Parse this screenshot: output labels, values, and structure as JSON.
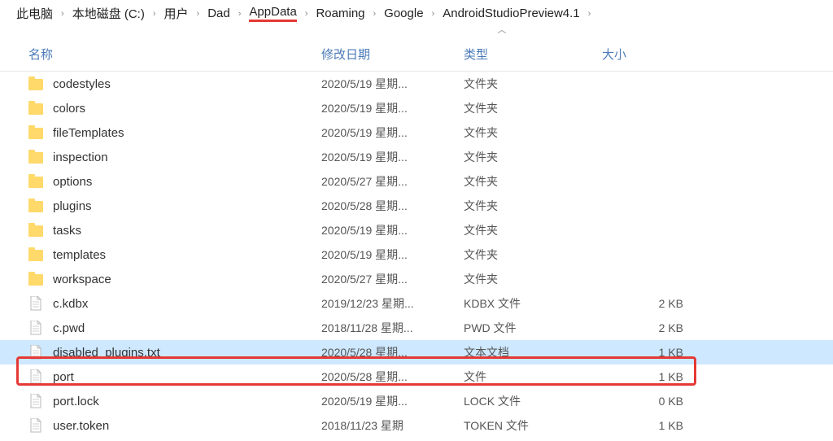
{
  "breadcrumb": {
    "items": [
      "此电脑",
      "本地磁盘 (C:)",
      "用户",
      "Dad",
      "AppData",
      "Roaming",
      "Google",
      "AndroidStudioPreview4.1"
    ],
    "highlighted_index": 4
  },
  "columns": {
    "name": "名称",
    "date": "修改日期",
    "type": "类型",
    "size": "大小"
  },
  "rows": [
    {
      "icon": "folder",
      "name": "codestyles",
      "date": "2020/5/19 星期...",
      "type": "文件夹",
      "size": ""
    },
    {
      "icon": "folder",
      "name": "colors",
      "date": "2020/5/19 星期...",
      "type": "文件夹",
      "size": ""
    },
    {
      "icon": "folder",
      "name": "fileTemplates",
      "date": "2020/5/19 星期...",
      "type": "文件夹",
      "size": ""
    },
    {
      "icon": "folder",
      "name": "inspection",
      "date": "2020/5/19 星期...",
      "type": "文件夹",
      "size": ""
    },
    {
      "icon": "folder",
      "name": "options",
      "date": "2020/5/27 星期...",
      "type": "文件夹",
      "size": ""
    },
    {
      "icon": "folder",
      "name": "plugins",
      "date": "2020/5/28 星期...",
      "type": "文件夹",
      "size": ""
    },
    {
      "icon": "folder",
      "name": "tasks",
      "date": "2020/5/19 星期...",
      "type": "文件夹",
      "size": ""
    },
    {
      "icon": "folder",
      "name": "templates",
      "date": "2020/5/19 星期...",
      "type": "文件夹",
      "size": ""
    },
    {
      "icon": "folder",
      "name": "workspace",
      "date": "2020/5/27 星期...",
      "type": "文件夹",
      "size": ""
    },
    {
      "icon": "file",
      "name": "c.kdbx",
      "date": "2019/12/23 星期...",
      "type": "KDBX 文件",
      "size": "2 KB"
    },
    {
      "icon": "file",
      "name": "c.pwd",
      "date": "2018/11/28 星期...",
      "type": "PWD 文件",
      "size": "2 KB"
    },
    {
      "icon": "file",
      "name": "disabled_plugins.txt",
      "date": "2020/5/28 星期...",
      "type": "文本文档",
      "size": "1 KB",
      "selected": true
    },
    {
      "icon": "file",
      "name": "port",
      "date": "2020/5/28 星期...",
      "type": "文件",
      "size": "1 KB"
    },
    {
      "icon": "file",
      "name": "port.lock",
      "date": "2020/5/19 星期...",
      "type": "LOCK 文件",
      "size": "0 KB"
    },
    {
      "icon": "file",
      "name": "user.token",
      "date": "2018/11/23 星期",
      "type": "TOKEN 文件",
      "size": "1 KB"
    }
  ]
}
